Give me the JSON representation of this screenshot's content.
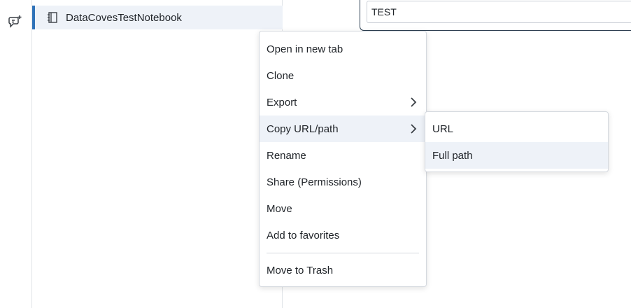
{
  "rail": {
    "icon": "assistant-sparkle-icon"
  },
  "tree": {
    "selected_item": {
      "icon": "notebook-icon",
      "label": "DataCovesTestNotebook"
    }
  },
  "title_input": {
    "value": "TEST"
  },
  "context_menu": {
    "items": [
      {
        "label": "Open in new tab"
      },
      {
        "label": "Clone"
      },
      {
        "label": "Export",
        "has_submenu": true
      },
      {
        "label": "Copy URL/path",
        "has_submenu": true,
        "active": true
      },
      {
        "label": "Rename"
      },
      {
        "label": "Share (Permissions)"
      },
      {
        "label": "Move"
      },
      {
        "label": "Add to favorites"
      },
      {
        "label": "Move to Trash"
      }
    ]
  },
  "submenu": {
    "items": [
      {
        "label": "URL"
      },
      {
        "label": "Full path",
        "active": true
      }
    ]
  },
  "colors": {
    "accent": "#2f72b8",
    "highlight": "#eef2f8",
    "border": "#d5d9df"
  }
}
